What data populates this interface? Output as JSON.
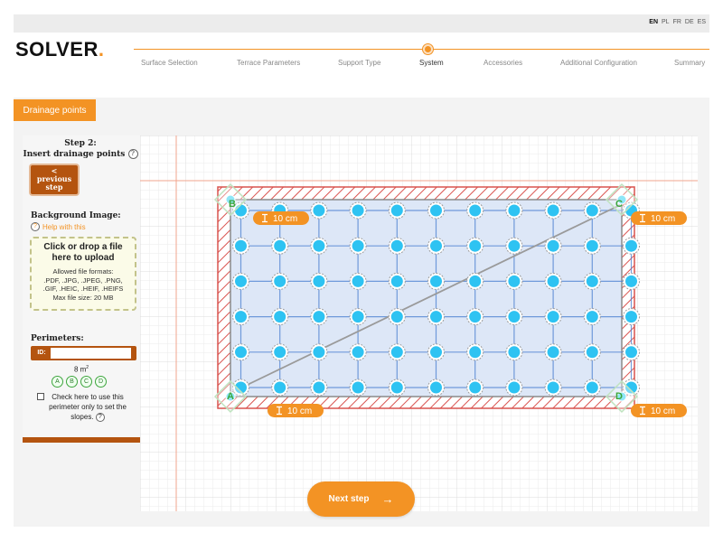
{
  "languages": [
    "EN",
    "PL",
    "FR",
    "DE",
    "ES"
  ],
  "active_language": "EN",
  "logo": {
    "text": "SOLVER",
    "dot": "."
  },
  "stepper": {
    "steps": [
      "Surface Selection",
      "Terrace Parameters",
      "Support Type",
      "System",
      "Accessories",
      "Additional Configuration",
      "Summary"
    ],
    "current": "System"
  },
  "section_tab": "Drainage points",
  "panel": {
    "step_title_line1": "Step 2:",
    "step_title_line2": "Insert drainage points",
    "help_glyph": "?",
    "prev_arrow": "<",
    "prev_line1": "previous",
    "prev_line2": "step",
    "background_label": "Background Image:",
    "help_link": "Help with this",
    "upload_title_line1": "Click or drop a file",
    "upload_title_line2": "here to upload",
    "upload_info_line1": "Allowed file formats:",
    "upload_info_line2": ".PDF, .JPG, .JPEG, .PNG,",
    "upload_info_line3": ".GIF, .HEIC, .HEIF, .HEIFS",
    "upload_info_line4": "Max file size: 20 MB",
    "perimeters_label": "Perimeters:",
    "id_label": "ID:",
    "id_value": "",
    "area_value": "8 m",
    "area_unit_sup": "2",
    "corner_labels": [
      "A",
      "B",
      "C",
      "D"
    ],
    "checkbox_checked": false,
    "checkbox_line1": "Check here to use this",
    "checkbox_line2": "perimeter only to set the",
    "checkbox_line3": "slopes."
  },
  "canvas": {
    "corners": {
      "A": "A",
      "B": "B",
      "C": "C",
      "D": "D"
    },
    "offset_labels": [
      "10 cm",
      "10 cm",
      "10 cm"
    ],
    "grid_columns": 10,
    "grid_rows": 5,
    "colors": {
      "accent": "#f39324",
      "hatch": "#d9534f",
      "point": "#2ec3f2",
      "grid_line": "#4a7fd1",
      "surface": "#dde7f7"
    }
  },
  "next_button": {
    "label": "Next step",
    "arrow": "→"
  }
}
